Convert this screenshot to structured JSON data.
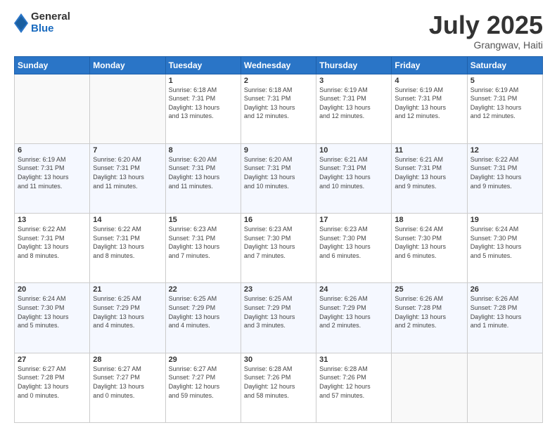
{
  "logo": {
    "general": "General",
    "blue": "Blue"
  },
  "header": {
    "month": "July 2025",
    "location": "Grangwav, Haiti"
  },
  "weekdays": [
    "Sunday",
    "Monday",
    "Tuesday",
    "Wednesday",
    "Thursday",
    "Friday",
    "Saturday"
  ],
  "weeks": [
    [
      {
        "day": "",
        "info": ""
      },
      {
        "day": "",
        "info": ""
      },
      {
        "day": "1",
        "info": "Sunrise: 6:18 AM\nSunset: 7:31 PM\nDaylight: 13 hours\nand 13 minutes."
      },
      {
        "day": "2",
        "info": "Sunrise: 6:18 AM\nSunset: 7:31 PM\nDaylight: 13 hours\nand 12 minutes."
      },
      {
        "day": "3",
        "info": "Sunrise: 6:19 AM\nSunset: 7:31 PM\nDaylight: 13 hours\nand 12 minutes."
      },
      {
        "day": "4",
        "info": "Sunrise: 6:19 AM\nSunset: 7:31 PM\nDaylight: 13 hours\nand 12 minutes."
      },
      {
        "day": "5",
        "info": "Sunrise: 6:19 AM\nSunset: 7:31 PM\nDaylight: 13 hours\nand 12 minutes."
      }
    ],
    [
      {
        "day": "6",
        "info": "Sunrise: 6:19 AM\nSunset: 7:31 PM\nDaylight: 13 hours\nand 11 minutes."
      },
      {
        "day": "7",
        "info": "Sunrise: 6:20 AM\nSunset: 7:31 PM\nDaylight: 13 hours\nand 11 minutes."
      },
      {
        "day": "8",
        "info": "Sunrise: 6:20 AM\nSunset: 7:31 PM\nDaylight: 13 hours\nand 11 minutes."
      },
      {
        "day": "9",
        "info": "Sunrise: 6:20 AM\nSunset: 7:31 PM\nDaylight: 13 hours\nand 10 minutes."
      },
      {
        "day": "10",
        "info": "Sunrise: 6:21 AM\nSunset: 7:31 PM\nDaylight: 13 hours\nand 10 minutes."
      },
      {
        "day": "11",
        "info": "Sunrise: 6:21 AM\nSunset: 7:31 PM\nDaylight: 13 hours\nand 9 minutes."
      },
      {
        "day": "12",
        "info": "Sunrise: 6:22 AM\nSunset: 7:31 PM\nDaylight: 13 hours\nand 9 minutes."
      }
    ],
    [
      {
        "day": "13",
        "info": "Sunrise: 6:22 AM\nSunset: 7:31 PM\nDaylight: 13 hours\nand 8 minutes."
      },
      {
        "day": "14",
        "info": "Sunrise: 6:22 AM\nSunset: 7:31 PM\nDaylight: 13 hours\nand 8 minutes."
      },
      {
        "day": "15",
        "info": "Sunrise: 6:23 AM\nSunset: 7:31 PM\nDaylight: 13 hours\nand 7 minutes."
      },
      {
        "day": "16",
        "info": "Sunrise: 6:23 AM\nSunset: 7:30 PM\nDaylight: 13 hours\nand 7 minutes."
      },
      {
        "day": "17",
        "info": "Sunrise: 6:23 AM\nSunset: 7:30 PM\nDaylight: 13 hours\nand 6 minutes."
      },
      {
        "day": "18",
        "info": "Sunrise: 6:24 AM\nSunset: 7:30 PM\nDaylight: 13 hours\nand 6 minutes."
      },
      {
        "day": "19",
        "info": "Sunrise: 6:24 AM\nSunset: 7:30 PM\nDaylight: 13 hours\nand 5 minutes."
      }
    ],
    [
      {
        "day": "20",
        "info": "Sunrise: 6:24 AM\nSunset: 7:30 PM\nDaylight: 13 hours\nand 5 minutes."
      },
      {
        "day": "21",
        "info": "Sunrise: 6:25 AM\nSunset: 7:29 PM\nDaylight: 13 hours\nand 4 minutes."
      },
      {
        "day": "22",
        "info": "Sunrise: 6:25 AM\nSunset: 7:29 PM\nDaylight: 13 hours\nand 4 minutes."
      },
      {
        "day": "23",
        "info": "Sunrise: 6:25 AM\nSunset: 7:29 PM\nDaylight: 13 hours\nand 3 minutes."
      },
      {
        "day": "24",
        "info": "Sunrise: 6:26 AM\nSunset: 7:29 PM\nDaylight: 13 hours\nand 2 minutes."
      },
      {
        "day": "25",
        "info": "Sunrise: 6:26 AM\nSunset: 7:28 PM\nDaylight: 13 hours\nand 2 minutes."
      },
      {
        "day": "26",
        "info": "Sunrise: 6:26 AM\nSunset: 7:28 PM\nDaylight: 13 hours\nand 1 minute."
      }
    ],
    [
      {
        "day": "27",
        "info": "Sunrise: 6:27 AM\nSunset: 7:28 PM\nDaylight: 13 hours\nand 0 minutes."
      },
      {
        "day": "28",
        "info": "Sunrise: 6:27 AM\nSunset: 7:27 PM\nDaylight: 13 hours\nand 0 minutes."
      },
      {
        "day": "29",
        "info": "Sunrise: 6:27 AM\nSunset: 7:27 PM\nDaylight: 12 hours\nand 59 minutes."
      },
      {
        "day": "30",
        "info": "Sunrise: 6:28 AM\nSunset: 7:26 PM\nDaylight: 12 hours\nand 58 minutes."
      },
      {
        "day": "31",
        "info": "Sunrise: 6:28 AM\nSunset: 7:26 PM\nDaylight: 12 hours\nand 57 minutes."
      },
      {
        "day": "",
        "info": ""
      },
      {
        "day": "",
        "info": ""
      }
    ]
  ]
}
